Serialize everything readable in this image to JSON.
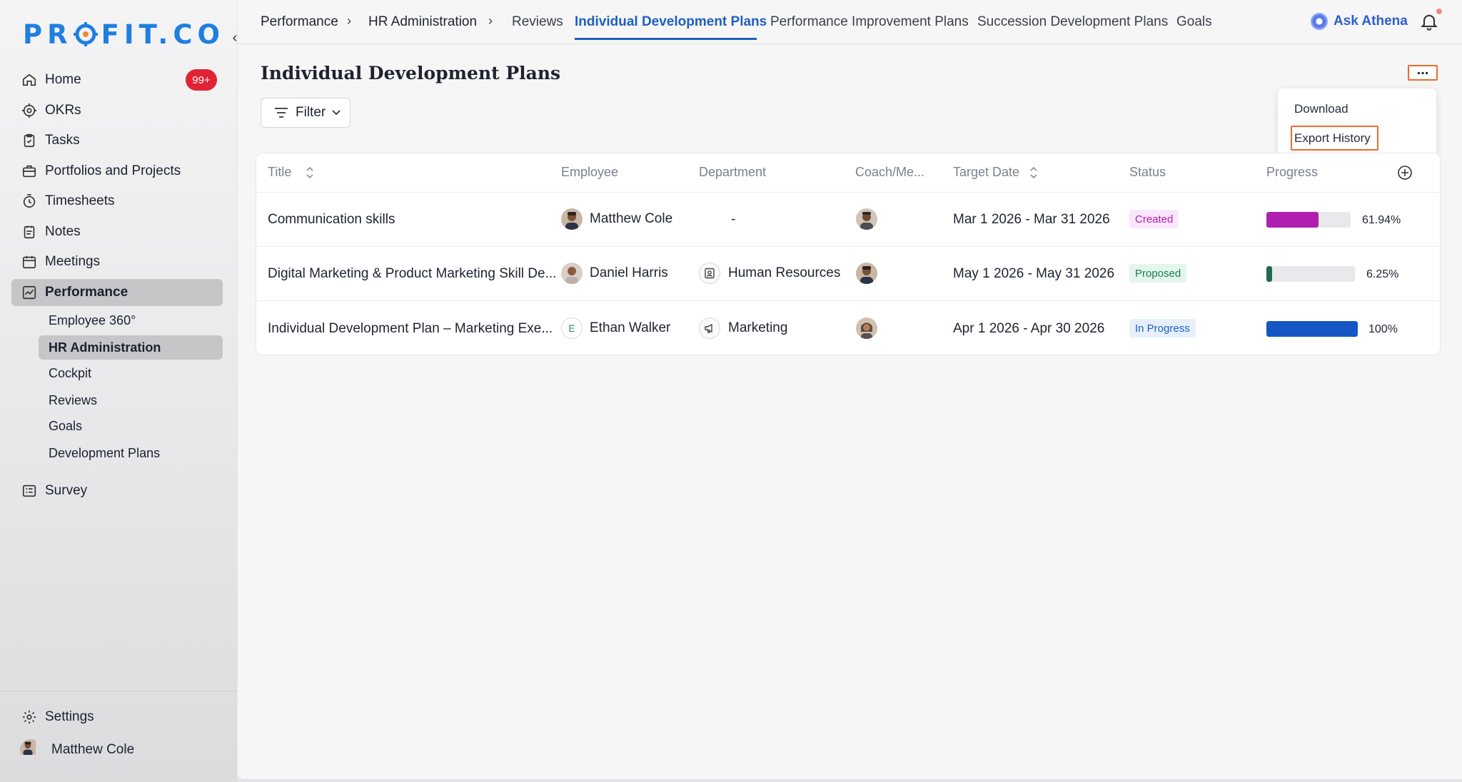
{
  "brand": {
    "logo_text_left": "PR",
    "logo_text_right": "FIT.CO"
  },
  "sidebar": {
    "items": [
      {
        "label": "Home",
        "badge": "99+"
      },
      {
        "label": "OKRs"
      },
      {
        "label": "Tasks"
      },
      {
        "label": "Portfolios and Projects"
      },
      {
        "label": "Timesheets"
      },
      {
        "label": "Notes"
      },
      {
        "label": "Meetings"
      },
      {
        "label": "Performance"
      },
      {
        "label": "Survey"
      }
    ],
    "sub_items": [
      "Employee 360°",
      "HR Administration",
      "Cockpit",
      "Reviews",
      "Goals",
      "Development Plans"
    ],
    "settings_label": "Settings",
    "user_name": "Matthew Cole"
  },
  "topbar": {
    "breadcrumb": [
      "Performance",
      "HR Administration"
    ],
    "separator": "›",
    "tabs": [
      "Reviews",
      "Individual Development Plans",
      "Performance Improvement Plans",
      "Succession Development Plans",
      "Goals"
    ],
    "active_tab": "Individual Development Plans",
    "ask_label": "Ask Athena"
  },
  "page": {
    "title": "Individual Development Plans",
    "filter_label": "Filter",
    "more_label": "...",
    "menu": [
      "Download",
      "Export History"
    ]
  },
  "table": {
    "headers": [
      "Title",
      "Employee",
      "Department",
      "Coach/Me...",
      "Target Date",
      "Status",
      "Progress"
    ],
    "rows": [
      {
        "title": "Communication skills",
        "employee": "Matthew Cole",
        "department": "-",
        "target_date": "Mar 1 2026 - Mar 31 2026",
        "status": "Created",
        "progress": 61.94,
        "progress_label": "61.94%"
      },
      {
        "title": "Digital Marketing & Product Marketing Skill De...",
        "employee": "Daniel Harris",
        "department": "Human Resources",
        "target_date": "May 1 2026 - May 31 2026",
        "status": "Proposed",
        "progress": 6.25,
        "progress_label": "6.25%"
      },
      {
        "title": "Individual Development Plan – Marketing Exe...",
        "employee": "Ethan Walker",
        "employee_initial": "E",
        "department": "Marketing",
        "target_date": "Apr 1 2026 - Apr 30 2026",
        "status": "In Progress",
        "progress": 100,
        "progress_label": "100%"
      }
    ]
  },
  "colors": {
    "accent": "#1f5fc2",
    "highlight": "#ef6a2c",
    "created": "#b01fb0",
    "proposed": "#1f7a55",
    "in_progress": "#1f5fc2"
  }
}
